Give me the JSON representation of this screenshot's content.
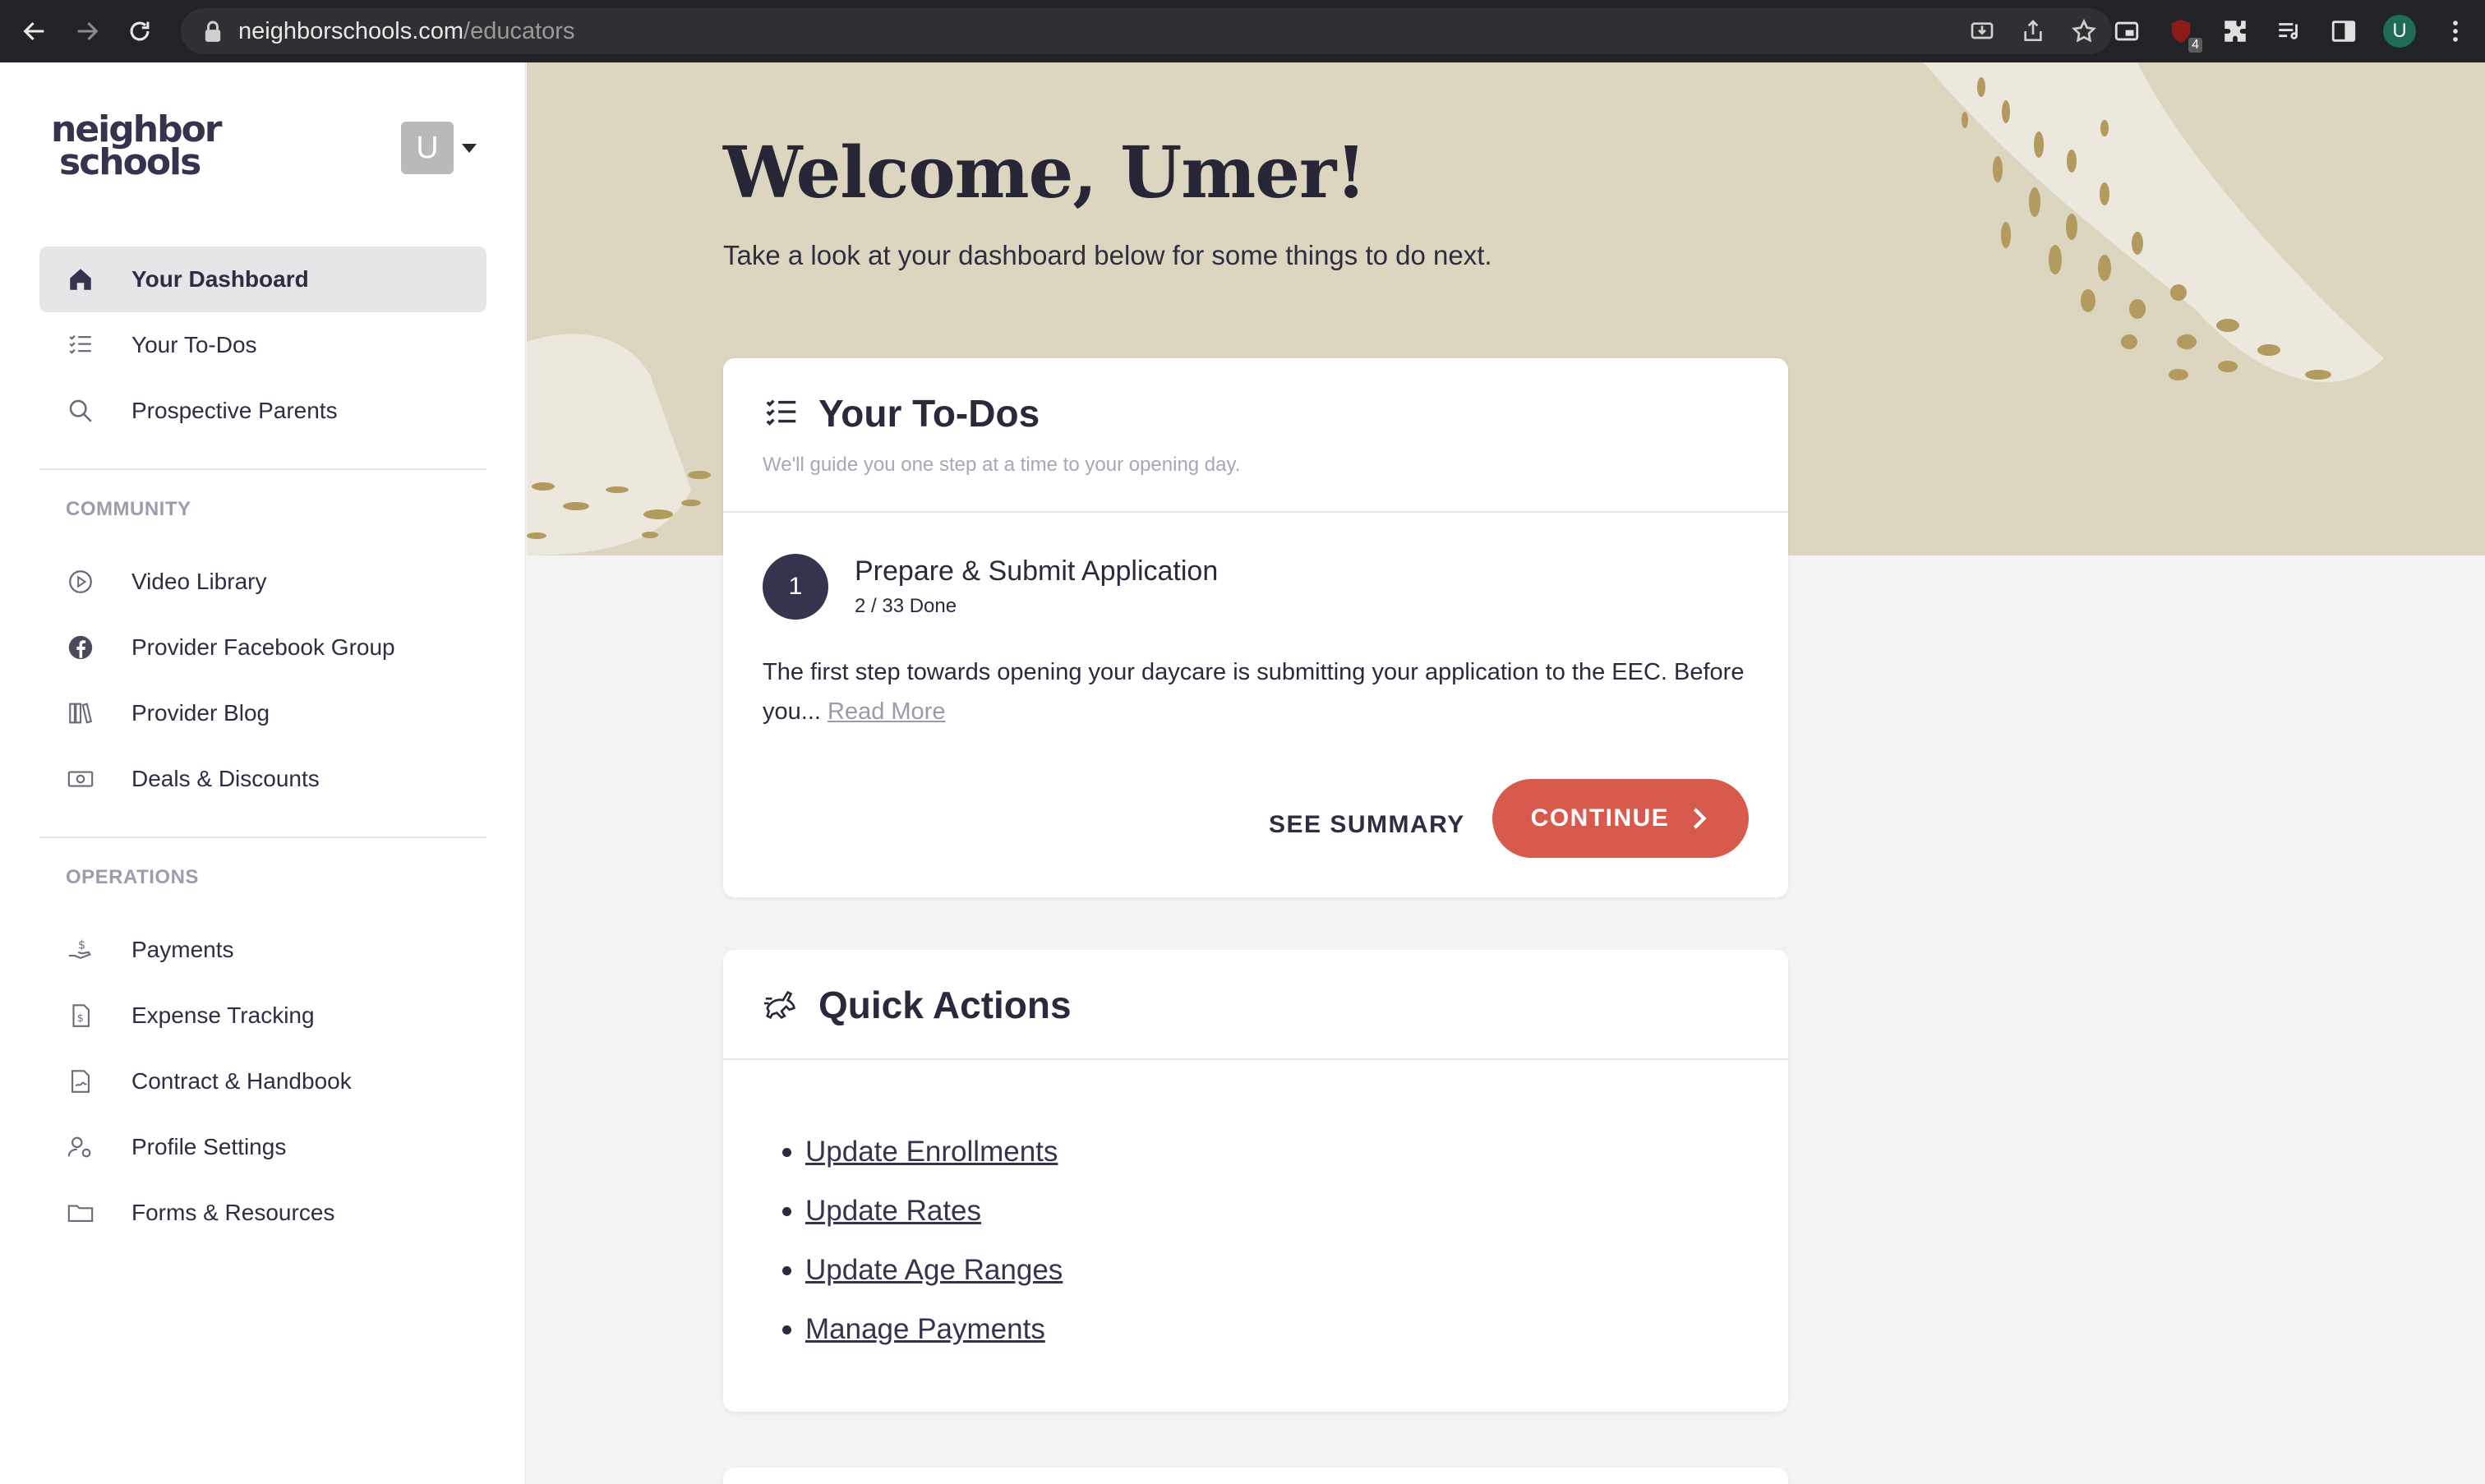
{
  "browser": {
    "url_host": "neighborschools.com",
    "url_path": "/educators",
    "profile_initial": "U",
    "extension_badge": "4"
  },
  "sidebar": {
    "logo_line1": "neighbor",
    "logo_line2": "schools",
    "user_initial": "U",
    "main_items": [
      {
        "label": "Your Dashboard",
        "icon": "home-icon"
      },
      {
        "label": "Your To-Dos",
        "icon": "checklist-icon"
      },
      {
        "label": "Prospective Parents",
        "icon": "search-icon"
      }
    ],
    "community_label": "COMMUNITY",
    "community_items": [
      {
        "label": "Video Library",
        "icon": "play-circle-icon"
      },
      {
        "label": "Provider Facebook Group",
        "icon": "facebook-icon"
      },
      {
        "label": "Provider Blog",
        "icon": "books-icon"
      },
      {
        "label": "Deals & Discounts",
        "icon": "cash-icon"
      }
    ],
    "operations_label": "OPERATIONS",
    "operations_items": [
      {
        "label": "Payments",
        "icon": "hand-dollar-icon"
      },
      {
        "label": "Expense Tracking",
        "icon": "receipt-icon"
      },
      {
        "label": "Contract & Handbook",
        "icon": "document-sign-icon"
      },
      {
        "label": "Profile Settings",
        "icon": "user-gear-icon"
      },
      {
        "label": "Forms & Resources",
        "icon": "folder-icon"
      }
    ]
  },
  "hero": {
    "title": "Welcome, Umer!",
    "subtitle": "Take a look at your dashboard below for some things to do next."
  },
  "todos": {
    "title": "Your To-Dos",
    "subtitle": "We'll guide you one step at a time to your opening day.",
    "step_number": "1",
    "step_title": "Prepare & Submit Application",
    "step_progress": "2 / 33 Done",
    "step_desc": "The first step towards opening your daycare is submitting your application to the EEC. Before you...",
    "read_more": "Read More",
    "see_summary": "SEE SUMMARY",
    "continue": "CONTINUE"
  },
  "quick_actions": {
    "title": "Quick Actions",
    "links": [
      "Update Enrollments",
      "Update Rates",
      "Update Age Ranges",
      "Manage Payments"
    ]
  },
  "colors": {
    "accent": "#d85a4c",
    "navy": "#35344f",
    "hero_bg": "#dcd5c0",
    "brush": "#b39a5e"
  }
}
